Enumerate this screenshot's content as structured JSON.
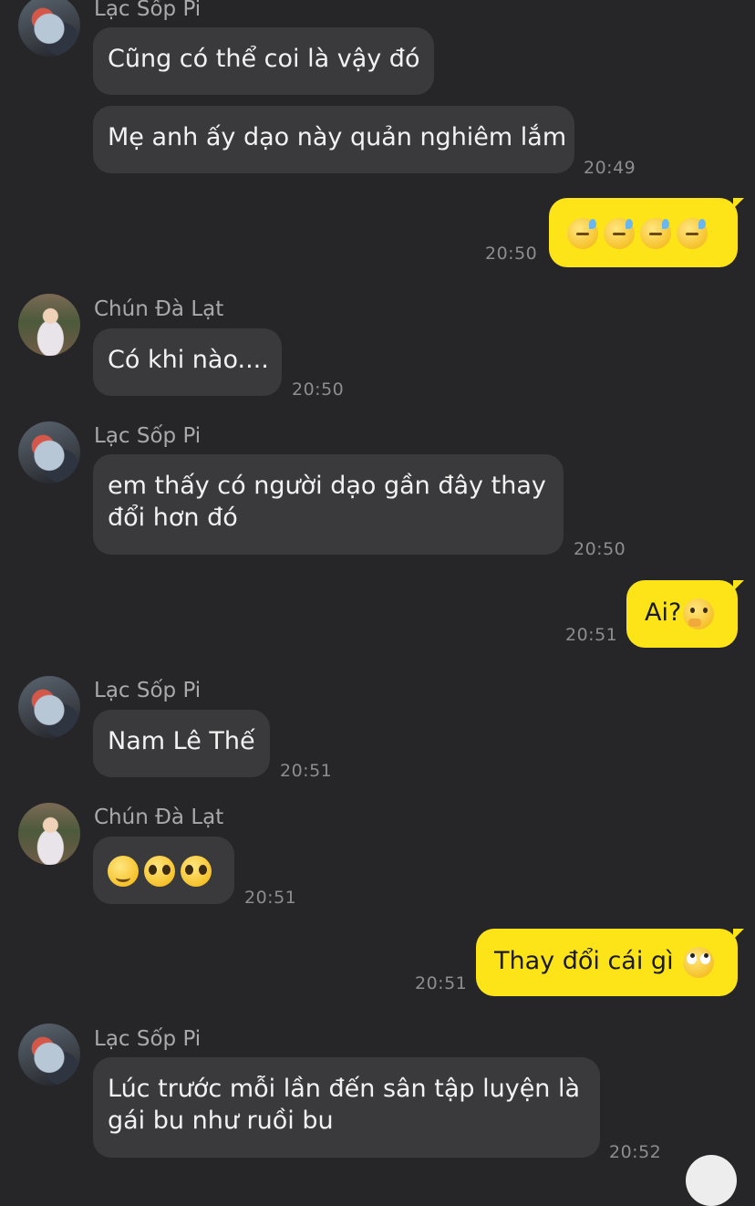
{
  "messages": [
    {
      "sender": "Lạc Sốp Pi",
      "text": "Cũng có thể coi là vậy đó"
    },
    {
      "text": "Mẹ anh ấy dạo này quản nghiêm lắm",
      "time": "20:49"
    },
    {
      "outgoing": true,
      "emoji": [
        "sweat",
        "sweat",
        "sweat",
        "sweat"
      ],
      "time": "20:50"
    },
    {
      "sender": "Chún Đà Lạt",
      "text": "Có khi nào....",
      "time": "20:50"
    },
    {
      "sender": "Lạc Sốp Pi",
      "text_lines": [
        "em thấy có người dạo gần đây thay",
        "đổi hơn đó"
      ],
      "time": "20:50"
    },
    {
      "outgoing": true,
      "text": "Ai?",
      "emoji": [
        "thinking"
      ],
      "time": "20:51"
    },
    {
      "sender": "Lạc Sốp Pi",
      "text": "Nam Lê Thế",
      "time": "20:51"
    },
    {
      "sender": "Chún Đà Lạt",
      "emoji": [
        "smile",
        "pleading",
        "pleading"
      ],
      "time": "20:51"
    },
    {
      "outgoing": true,
      "text": "Thay đổi cái gì",
      "emoji": [
        "eye-roll"
      ],
      "time": "20:51"
    },
    {
      "sender": "Lạc Sốp Pi",
      "text_lines": [
        "Lúc trước mỗi lần đến sân tập luyện là",
        "gái bu như ruồi bu"
      ],
      "time": "20:52"
    }
  ]
}
